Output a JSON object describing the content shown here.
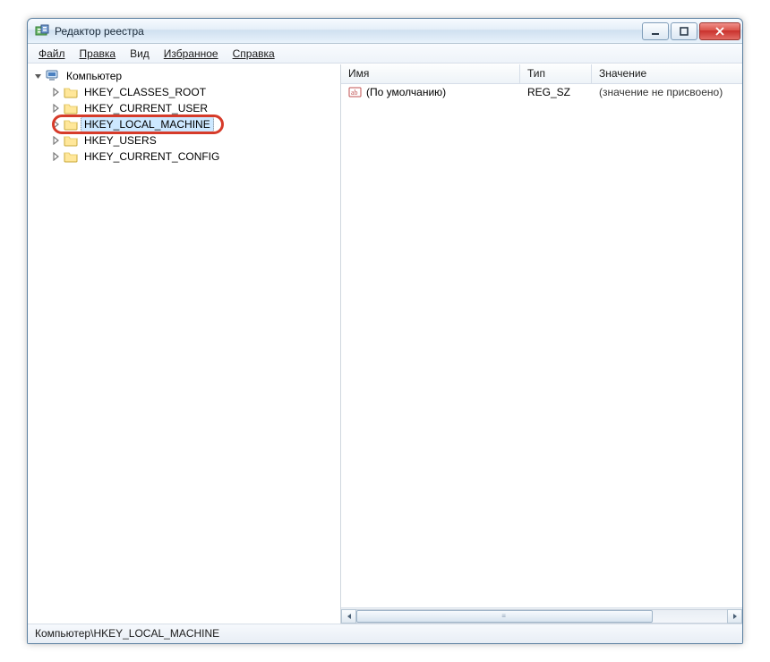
{
  "window": {
    "title": "Редактор реестра"
  },
  "menu": {
    "file": "Файл",
    "edit": "Правка",
    "view": "Вид",
    "favorites": "Избранное",
    "help": "Справка"
  },
  "tree": {
    "root": "Компьютер",
    "nodes": [
      "HKEY_CLASSES_ROOT",
      "HKEY_CURRENT_USER",
      "HKEY_LOCAL_MACHINE",
      "HKEY_USERS",
      "HKEY_CURRENT_CONFIG"
    ],
    "selected_index": 2
  },
  "list": {
    "columns": {
      "name": "Имя",
      "type": "Тип",
      "value": "Значение"
    },
    "rows": [
      {
        "name": "(По умолчанию)",
        "type": "REG_SZ",
        "value": "(значение не присвоено)"
      }
    ]
  },
  "status": {
    "path": "Компьютер\\HKEY_LOCAL_MACHINE"
  }
}
